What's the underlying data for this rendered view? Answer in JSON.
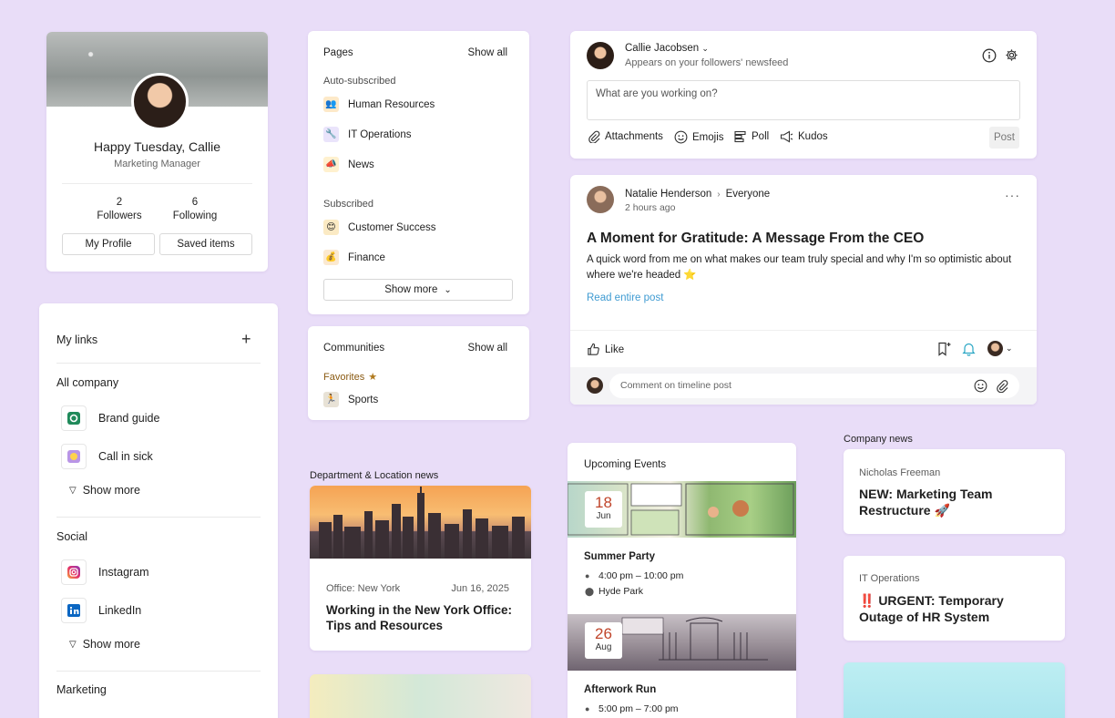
{
  "profile": {
    "greeting": "Happy Tuesday, Callie",
    "role": "Marketing Manager",
    "followers_count": "2",
    "followers_label": "Followers",
    "following_count": "6",
    "following_label": "Following",
    "my_profile_btn": "My Profile",
    "saved_items_btn": "Saved items"
  },
  "links": {
    "title": "My links",
    "add_icon": "+",
    "sections": [
      {
        "title": "All company",
        "items": [
          {
            "label": "Brand guide",
            "icon": "brand-guide-icon"
          },
          {
            "label": "Call in sick",
            "icon": "call-in-sick-icon"
          }
        ],
        "more": "Show more"
      },
      {
        "title": "Social",
        "items": [
          {
            "label": "Instagram",
            "icon": "instagram-icon"
          },
          {
            "label": "LinkedIn",
            "icon": "linkedin-icon"
          }
        ],
        "more": "Show more"
      },
      {
        "title": "Marketing"
      }
    ]
  },
  "pages": {
    "title": "Pages",
    "show_all": "Show all",
    "auto_heading": "Auto-subscribed",
    "auto_items": [
      "Human Resources",
      "IT Operations",
      "News"
    ],
    "sub_heading": "Subscribed",
    "sub_items": [
      "Customer Success",
      "Finance"
    ],
    "show_more": "Show more"
  },
  "communities": {
    "title": "Communities",
    "show_all": "Show all",
    "favorites": "Favorites",
    "items": [
      "Sports"
    ]
  },
  "dept_news": {
    "label": "Department & Location news",
    "office": "Office: New York",
    "date": "Jun 16, 2025",
    "headline": "Working in the New York Office: Tips and Resources"
  },
  "composer": {
    "name": "Callie Jacobsen",
    "subtitle": "Appears on your followers' newsfeed",
    "placeholder": "What are you working on?",
    "attachments": "Attachments",
    "emojis": "Emojis",
    "poll": "Poll",
    "kudos": "Kudos",
    "post": "Post"
  },
  "post": {
    "author": "Natalie Henderson",
    "audience": "Everyone",
    "time": "2 hours ago",
    "title": "A Moment for Gratitude: A Message From the CEO",
    "body": "A quick word from me on what makes our team truly special and why I'm so optimistic about where we're headed ⭐",
    "read_more": "Read entire post",
    "like": "Like",
    "comment_placeholder": "Comment on timeline post"
  },
  "events": {
    "title": "Upcoming Events",
    "items": [
      {
        "day": "18",
        "month": "Jun",
        "name": "Summer Party",
        "time": "4:00 pm – 10:00 pm",
        "place": "Hyde Park"
      },
      {
        "day": "26",
        "month": "Aug",
        "name": "Afterwork Run",
        "time": "5:00 pm – 7:00 pm"
      }
    ]
  },
  "company_news": {
    "label": "Company news",
    "items": [
      {
        "source": "Nicholas Freeman",
        "title": "NEW: Marketing Team Restructure 🚀"
      },
      {
        "source": "IT Operations",
        "title": "‼️ URGENT: Temporary Outage of HR System"
      }
    ]
  },
  "colors": {
    "background": "#e9ddf8",
    "link": "#3f9bd2",
    "date_accent": "#c0452b",
    "favorites": "#8a5a12"
  }
}
